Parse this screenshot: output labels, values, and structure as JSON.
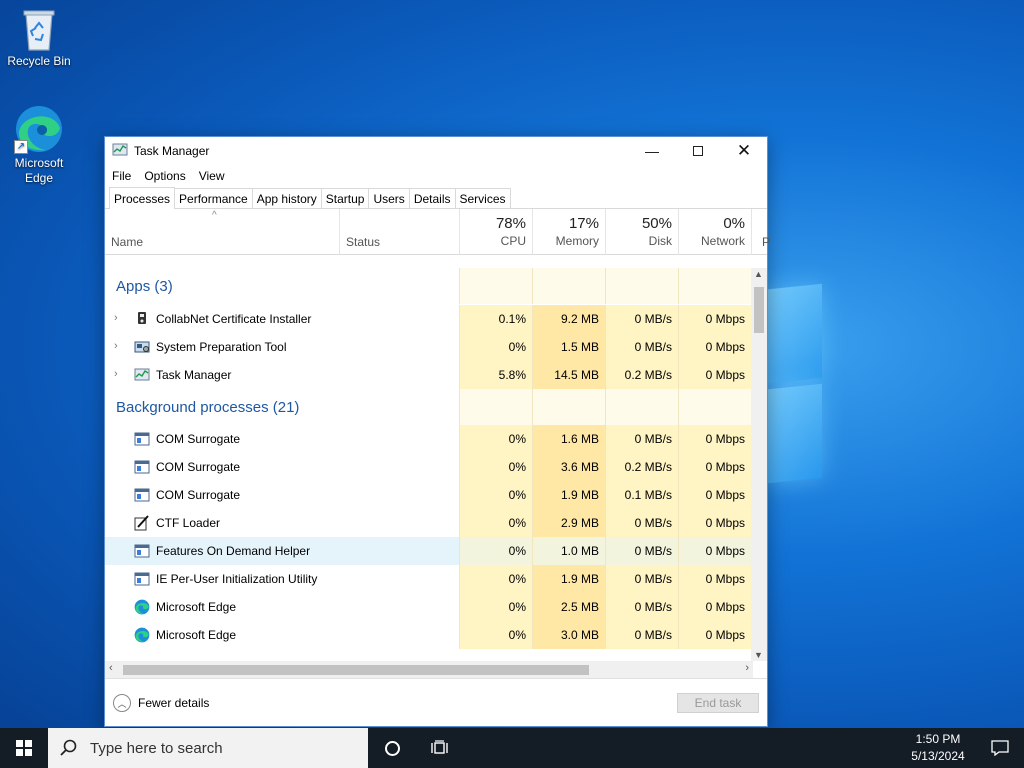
{
  "desktop": {
    "icons": [
      {
        "label": "Recycle Bin"
      },
      {
        "label_line1": "Microsoft",
        "label_line2": "Edge"
      }
    ]
  },
  "window": {
    "title": "Task Manager",
    "menu": [
      "File",
      "Options",
      "View"
    ],
    "tabs": [
      "Processes",
      "Performance",
      "App history",
      "Startup",
      "Users",
      "Details",
      "Services"
    ],
    "active_tab": "Processes",
    "columns": {
      "name": "Name",
      "status": "Status",
      "cpu": {
        "pct": "78%",
        "label": "CPU"
      },
      "memory": {
        "pct": "17%",
        "label": "Memory"
      },
      "disk": {
        "pct": "50%",
        "label": "Disk"
      },
      "network": {
        "pct": "0%",
        "label": "Network"
      },
      "power_partial": "P"
    },
    "groups": {
      "apps": "Apps (3)",
      "background": "Background processes (21)"
    },
    "apps": [
      {
        "name": "CollabNet Certificate Installer",
        "icon": "installer-icon",
        "cpu": "0.1%",
        "memory": "9.2 MB",
        "disk": "0 MB/s",
        "network": "0 Mbps"
      },
      {
        "name": "System Preparation Tool",
        "icon": "sysprep-icon",
        "cpu": "0%",
        "memory": "1.5 MB",
        "disk": "0 MB/s",
        "network": "0 Mbps"
      },
      {
        "name": "Task Manager",
        "icon": "taskmgr-icon",
        "cpu": "5.8%",
        "memory": "14.5 MB",
        "disk": "0.2 MB/s",
        "network": "0 Mbps"
      }
    ],
    "background": [
      {
        "name": "COM Surrogate",
        "icon": "window-icon",
        "cpu": "0%",
        "memory": "1.6 MB",
        "disk": "0 MB/s",
        "network": "0 Mbps"
      },
      {
        "name": "COM Surrogate",
        "icon": "window-icon",
        "cpu": "0%",
        "memory": "3.6 MB",
        "disk": "0.2 MB/s",
        "network": "0 Mbps"
      },
      {
        "name": "COM Surrogate",
        "icon": "window-icon",
        "cpu": "0%",
        "memory": "1.9 MB",
        "disk": "0.1 MB/s",
        "network": "0 Mbps"
      },
      {
        "name": "CTF Loader",
        "icon": "pen-icon",
        "cpu": "0%",
        "memory": "2.9 MB",
        "disk": "0 MB/s",
        "network": "0 Mbps"
      },
      {
        "name": "Features On Demand Helper",
        "icon": "window-icon",
        "cpu": "0%",
        "memory": "1.0 MB",
        "disk": "0 MB/s",
        "network": "0 Mbps"
      },
      {
        "name": "IE Per-User Initialization Utility",
        "icon": "window-icon",
        "cpu": "0%",
        "memory": "1.9 MB",
        "disk": "0 MB/s",
        "network": "0 Mbps"
      },
      {
        "name": "Microsoft Edge",
        "icon": "edge-icon",
        "cpu": "0%",
        "memory": "2.5 MB",
        "disk": "0 MB/s",
        "network": "0 Mbps"
      },
      {
        "name": "Microsoft Edge",
        "icon": "edge-icon",
        "cpu": "0%",
        "memory": "3.0 MB",
        "disk": "0 MB/s",
        "network": "0 Mbps"
      }
    ],
    "fewer_details": "Fewer details",
    "end_task": "End task"
  },
  "taskbar": {
    "search_placeholder": "Type here to search",
    "time": "1:50 PM",
    "date": "5/13/2024"
  },
  "colors": {
    "heat_light": "#fff4c4",
    "heat_mid": "#ffe8a6",
    "heat_row_bg": "#fffbea",
    "hover_row": "#e5f3fb",
    "group_text": "#1e57a3"
  }
}
